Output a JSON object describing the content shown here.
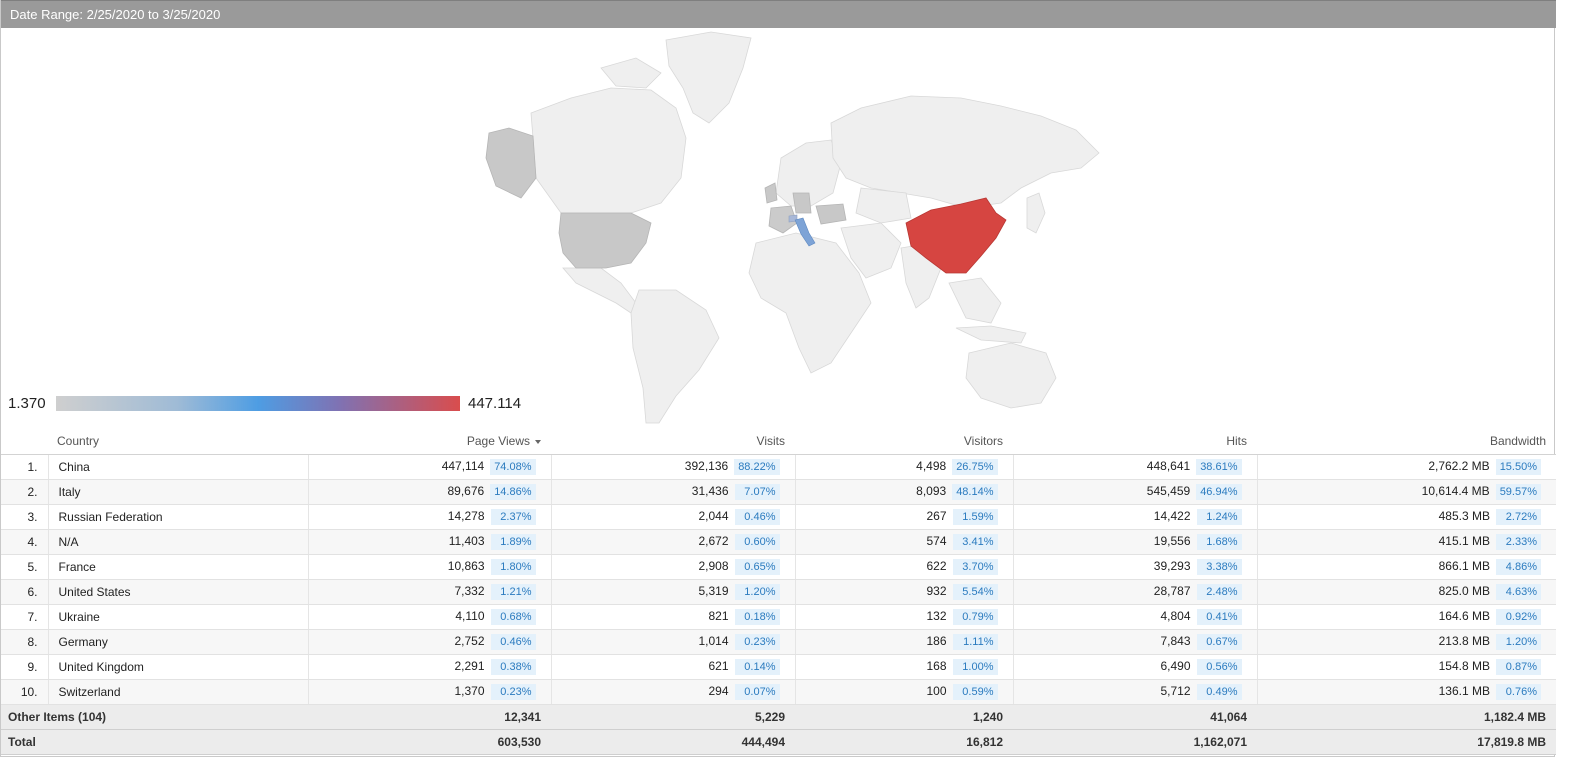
{
  "header": {
    "title": "Date Range: 2/25/2020 to 3/25/2020"
  },
  "legend": {
    "min": "1.370",
    "max": "447.114"
  },
  "colors": {
    "high": "#d64541",
    "mid": "#4e9de3",
    "low": "#cfcfcf",
    "base": "#efefef"
  },
  "columns": {
    "country": "Country",
    "page_views": "Page Views",
    "visits": "Visits",
    "visitors": "Visitors",
    "hits": "Hits",
    "bandwidth": "Bandwidth"
  },
  "rows": [
    {
      "rank": "1.",
      "country": "China",
      "pv": "447,114",
      "pv_pct": "74.08%",
      "visits": "392,136",
      "visits_pct": "88.22%",
      "visitors": "4,498",
      "visitors_pct": "26.75%",
      "hits": "448,641",
      "hits_pct": "38.61%",
      "bw": "2,762.2 MB",
      "bw_pct": "15.50%"
    },
    {
      "rank": "2.",
      "country": "Italy",
      "pv": "89,676",
      "pv_pct": "14.86%",
      "visits": "31,436",
      "visits_pct": "7.07%",
      "visitors": "8,093",
      "visitors_pct": "48.14%",
      "hits": "545,459",
      "hits_pct": "46.94%",
      "bw": "10,614.4 MB",
      "bw_pct": "59.57%"
    },
    {
      "rank": "3.",
      "country": "Russian Federation",
      "pv": "14,278",
      "pv_pct": "2.37%",
      "visits": "2,044",
      "visits_pct": "0.46%",
      "visitors": "267",
      "visitors_pct": "1.59%",
      "hits": "14,422",
      "hits_pct": "1.24%",
      "bw": "485.3 MB",
      "bw_pct": "2.72%"
    },
    {
      "rank": "4.",
      "country": "N/A",
      "pv": "11,403",
      "pv_pct": "1.89%",
      "visits": "2,672",
      "visits_pct": "0.60%",
      "visitors": "574",
      "visitors_pct": "3.41%",
      "hits": "19,556",
      "hits_pct": "1.68%",
      "bw": "415.1 MB",
      "bw_pct": "2.33%"
    },
    {
      "rank": "5.",
      "country": "France",
      "pv": "10,863",
      "pv_pct": "1.80%",
      "visits": "2,908",
      "visits_pct": "0.65%",
      "visitors": "622",
      "visitors_pct": "3.70%",
      "hits": "39,293",
      "hits_pct": "3.38%",
      "bw": "866.1 MB",
      "bw_pct": "4.86%"
    },
    {
      "rank": "6.",
      "country": "United States",
      "pv": "7,332",
      "pv_pct": "1.21%",
      "visits": "5,319",
      "visits_pct": "1.20%",
      "visitors": "932",
      "visitors_pct": "5.54%",
      "hits": "28,787",
      "hits_pct": "2.48%",
      "bw": "825.0 MB",
      "bw_pct": "4.63%"
    },
    {
      "rank": "7.",
      "country": "Ukraine",
      "pv": "4,110",
      "pv_pct": "0.68%",
      "visits": "821",
      "visits_pct": "0.18%",
      "visitors": "132",
      "visitors_pct": "0.79%",
      "hits": "4,804",
      "hits_pct": "0.41%",
      "bw": "164.6 MB",
      "bw_pct": "0.92%"
    },
    {
      "rank": "8.",
      "country": "Germany",
      "pv": "2,752",
      "pv_pct": "0.46%",
      "visits": "1,014",
      "visits_pct": "0.23%",
      "visitors": "186",
      "visitors_pct": "1.11%",
      "hits": "7,843",
      "hits_pct": "0.67%",
      "bw": "213.8 MB",
      "bw_pct": "1.20%"
    },
    {
      "rank": "9.",
      "country": "United Kingdom",
      "pv": "2,291",
      "pv_pct": "0.38%",
      "visits": "621",
      "visits_pct": "0.14%",
      "visitors": "168",
      "visitors_pct": "1.00%",
      "hits": "6,490",
      "hits_pct": "0.56%",
      "bw": "154.8 MB",
      "bw_pct": "0.87%"
    },
    {
      "rank": "10.",
      "country": "Switzerland",
      "pv": "1,370",
      "pv_pct": "0.23%",
      "visits": "294",
      "visits_pct": "0.07%",
      "visitors": "100",
      "visitors_pct": "0.59%",
      "hits": "5,712",
      "hits_pct": "0.49%",
      "bw": "136.1 MB",
      "bw_pct": "0.76%"
    }
  ],
  "other": {
    "label": "Other Items (104)",
    "pv": "12,341",
    "visits": "5,229",
    "visitors": "1,240",
    "hits": "41,064",
    "bw": "1,182.4 MB"
  },
  "total": {
    "label": "Total",
    "pv": "603,530",
    "visits": "444,494",
    "visitors": "16,812",
    "hits": "1,162,071",
    "bw": "17,819.8 MB"
  }
}
